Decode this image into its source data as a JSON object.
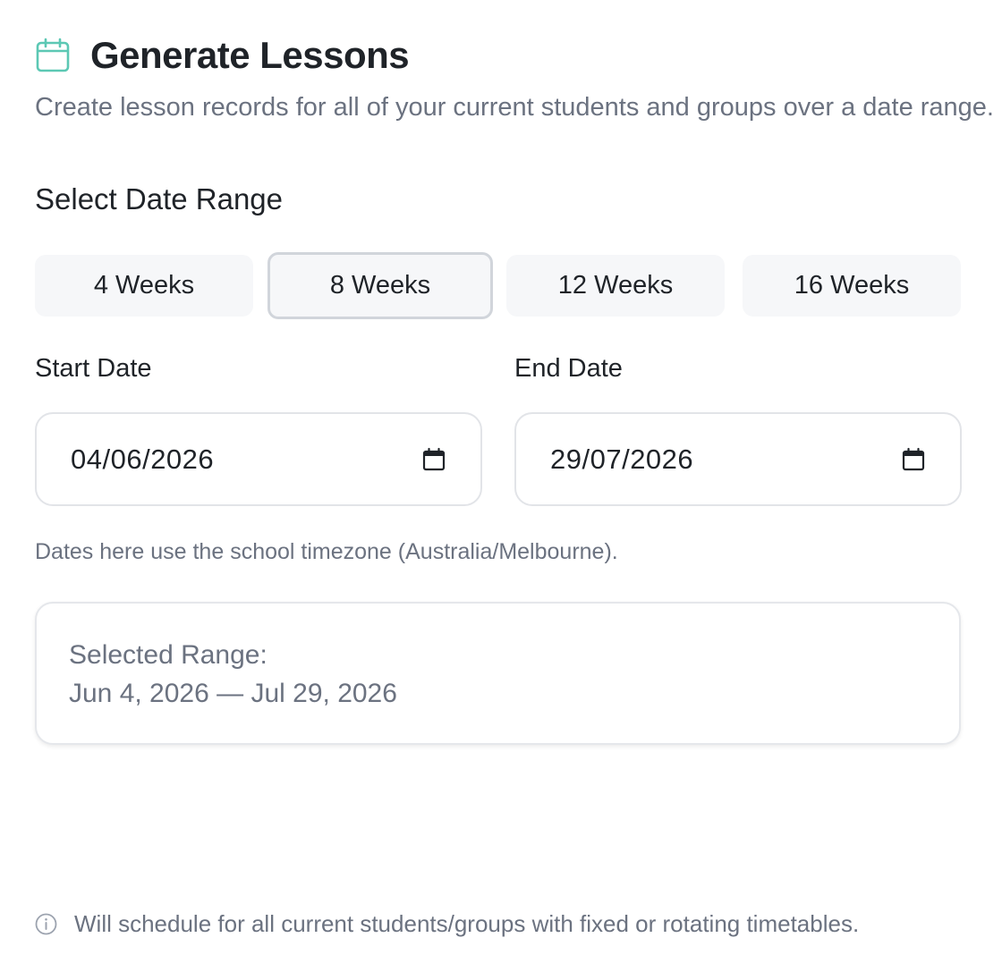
{
  "header": {
    "title": "Generate Lessons",
    "subtitle": "Create lesson records for all of your current students and groups over a date range."
  },
  "date_range": {
    "section_title": "Select Date Range",
    "presets": [
      {
        "label": "4 Weeks",
        "selected": false
      },
      {
        "label": "8 Weeks",
        "selected": true
      },
      {
        "label": "12 Weeks",
        "selected": false
      },
      {
        "label": "16 Weeks",
        "selected": false
      }
    ],
    "start_date": {
      "label": "Start Date",
      "value": "04/06/2026"
    },
    "end_date": {
      "label": "End Date",
      "value": "29/07/2026"
    },
    "timezone_note": "Dates here use the school timezone (Australia/Melbourne)."
  },
  "selected_range": {
    "label": "Selected Range:",
    "value": "Jun 4, 2026 — Jul 29, 2026"
  },
  "footer": {
    "note": "Will schedule for all current students/groups with fixed or rotating timetables."
  },
  "icons": {
    "header": "calendar-icon",
    "date_picker": "calendar-picker-icon",
    "footer": "info-icon"
  },
  "colors": {
    "accent": "#5cc8b4",
    "text_primary": "#1f2328",
    "text_muted": "#6b7280",
    "preset_bg": "#f6f7f9",
    "border": "#e2e4e8"
  }
}
